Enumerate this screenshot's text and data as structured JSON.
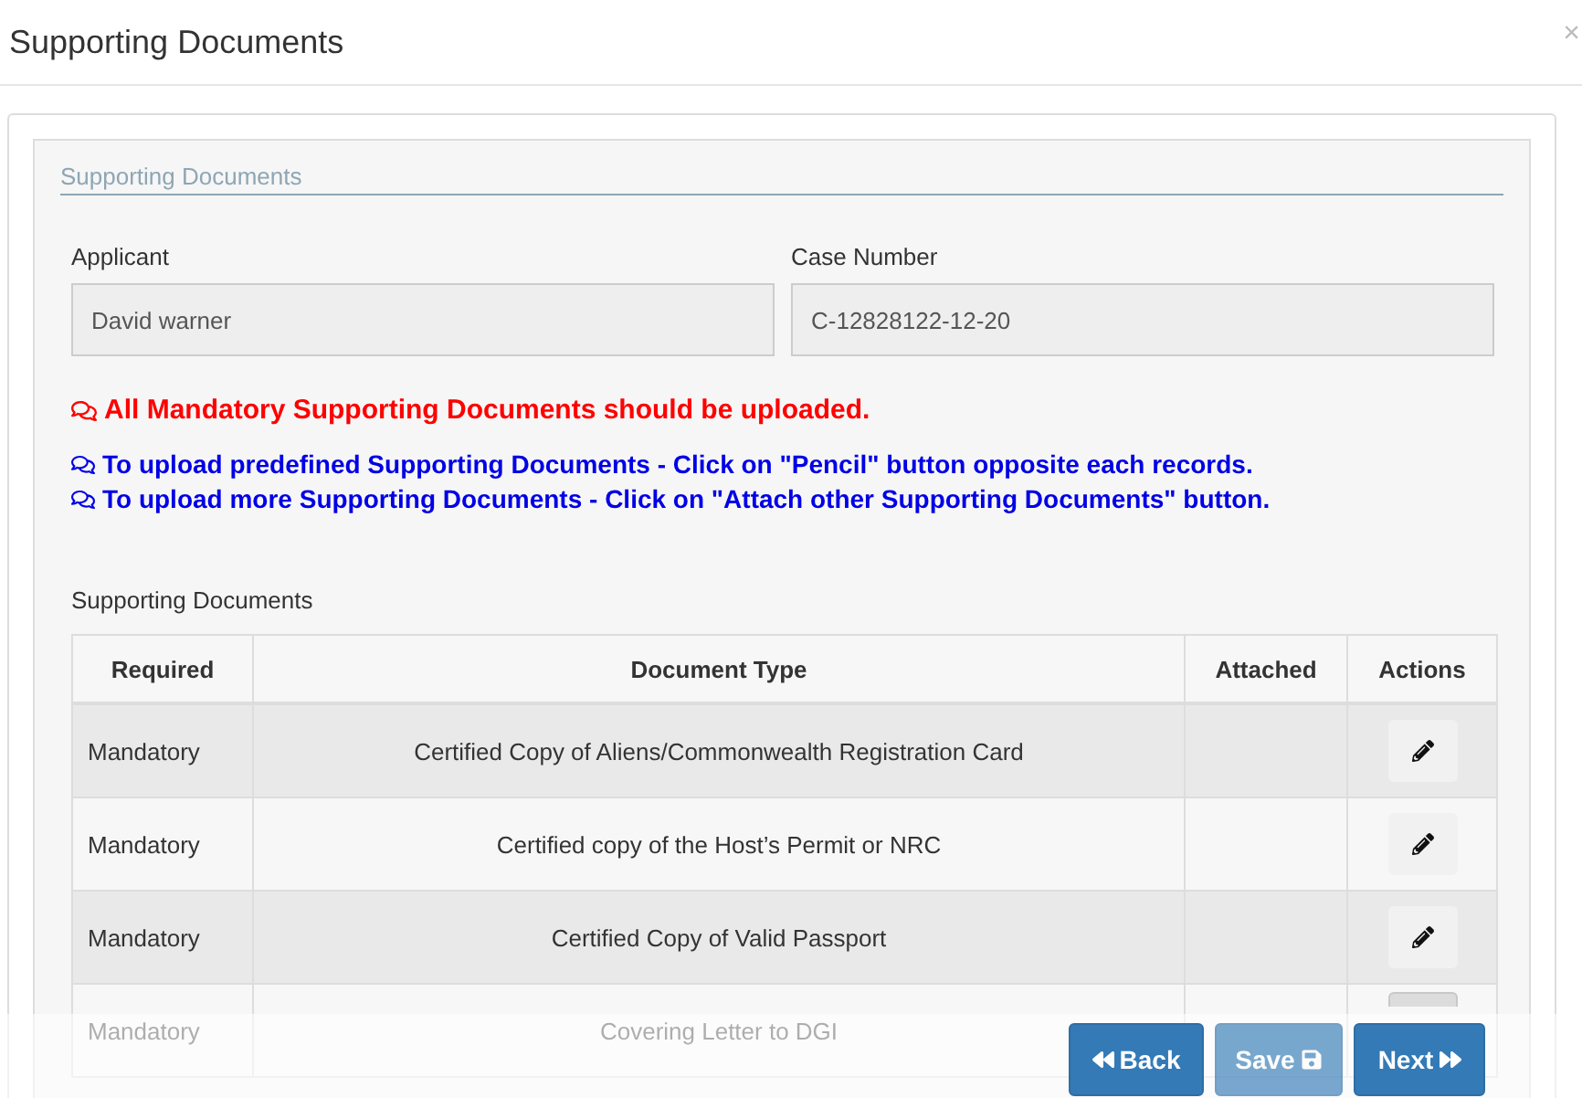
{
  "dialog": {
    "title": "Supporting Documents",
    "close": "×"
  },
  "section": {
    "legend": "Supporting Documents"
  },
  "fields": [
    {
      "label": "Applicant",
      "value": "David warner"
    },
    {
      "label": "Case Number",
      "value": "C-12828122-12-20"
    }
  ],
  "messages": [
    {
      "kind": "error",
      "text": "All Mandatory Supporting Documents should be uploaded."
    },
    {
      "kind": "info",
      "text": "To upload predefined Supporting Documents - Click on \"Pencil\" button opposite each records."
    },
    {
      "kind": "info",
      "text": "To upload more Supporting Documents - Click on \"Attach other Supporting Documents\" button."
    }
  ],
  "table": {
    "caption": "Supporting Documents",
    "columns": [
      "Required",
      "Document Type",
      "Attached",
      "Actions"
    ],
    "rows": [
      {
        "required": "Mandatory",
        "document_type": "Certified Copy of Aliens/Commonwealth Registration Card"
      },
      {
        "required": "Mandatory",
        "document_type": "Certified copy of the Host’s Permit or NRC"
      },
      {
        "required": "Mandatory",
        "document_type": "Certified Copy of Valid Passport"
      },
      {
        "required": "Mandatory",
        "document_type": "Covering Letter to DGI"
      }
    ]
  },
  "footer_buttons": [
    {
      "label": "Back",
      "kind": "back",
      "disabled": false
    },
    {
      "label": "Save",
      "kind": "save",
      "disabled": true
    },
    {
      "label": "Next",
      "kind": "next",
      "disabled": false
    }
  ]
}
